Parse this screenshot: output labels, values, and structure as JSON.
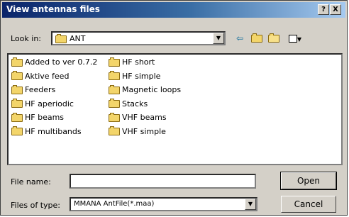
{
  "window": {
    "title": "View antennas files",
    "help_label": "?",
    "close_label": "X"
  },
  "lookin": {
    "label": "Look in:",
    "value": "ANT"
  },
  "toolbar": {
    "back_icon": "back-arrow-icon",
    "up_icon": "up-folder-icon",
    "new_icon": "new-folder-icon",
    "view_icon": "view-menu-icon"
  },
  "files": {
    "column1": [
      "Added to ver 0.7.2",
      "Aktive feed",
      "Feeders",
      "HF aperiodic",
      "HF beams",
      "HF multibands"
    ],
    "column2": [
      "HF short",
      "HF simple",
      "Magnetic loops",
      "Stacks",
      "VHF beams",
      "VHF simple"
    ]
  },
  "filename": {
    "label": "File name:",
    "value": ""
  },
  "filetype": {
    "label": "Files of type:",
    "value": "MMANA AntFile(*.maa)"
  },
  "buttons": {
    "open": "Open",
    "cancel": "Cancel"
  }
}
